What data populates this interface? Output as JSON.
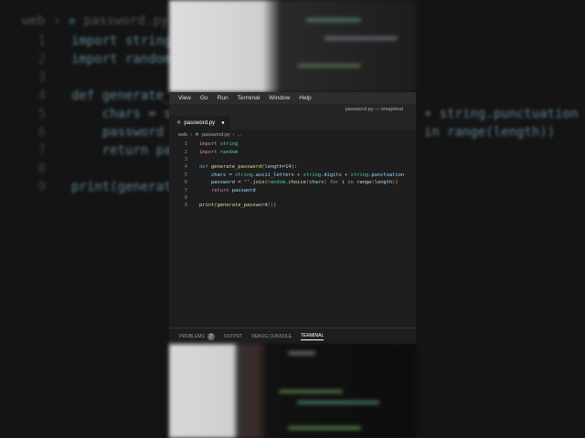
{
  "window": {
    "title": "password.py — imagetest"
  },
  "menu": [
    "View",
    "Go",
    "Run",
    "Terminal",
    "Window",
    "Help"
  ],
  "tab": {
    "label": "password.py",
    "modified_dot": "●"
  },
  "breadcrumb": {
    "folder": "web",
    "file": "password.py",
    "more": "..."
  },
  "code": [
    {
      "n": "1",
      "html": "<span class='k'>import</span> <span class='s'>string</span>"
    },
    {
      "n": "2",
      "html": "<span class='k'>import</span> <span class='s'>random</span>"
    },
    {
      "n": "3",
      "html": ""
    },
    {
      "n": "4",
      "html": "<span class='b'>def</span> <span class='f'>generate_password</span><span class='y'>(</span><span class='v'>length</span>=14<span class='y'>)</span>:"
    },
    {
      "n": "5",
      "html": "    <span class='v'>chars</span> = <span class='s'>string</span>.<span class='v'>ascii_letters</span> + <span class='s'>string</span>.<span class='v'>digits</span> + <span class='s'>string</span>.<span class='v'>punctuation</span>"
    },
    {
      "n": "6",
      "html": "    <span class='v'>password</span> = <span style='color:#ce9178'>\"\"</span>.<span class='f'>join</span><span class='y'>(</span><span class='s'>random</span>.<span class='f'>choice</span><span class='k'>(</span><span class='v'>chars</span><span class='k'>)</span> <span class='k'>for</span> <span class='v'>i</span> <span class='k'>in</span> <span class='f'>range</span><span class='k'>(</span><span class='v'>length</span><span class='k'>)</span><span class='y'>)</span>"
    },
    {
      "n": "7",
      "html": "    <span class='k'>return</span> <span class='v'>password</span>"
    },
    {
      "n": "8",
      "html": ""
    },
    {
      "n": "9",
      "html": "<span class='f'>print</span><span class='y'>(</span><span class='f'>generate_password</span><span class='k'>()</span><span class='y'>)</span>"
    }
  ],
  "panel": {
    "tabs": [
      "PROBLEMS",
      "OUTPUT",
      "DEBUG CONSOLE",
      "TERMINAL"
    ],
    "problems_count": "7",
    "active": "TERMINAL"
  }
}
